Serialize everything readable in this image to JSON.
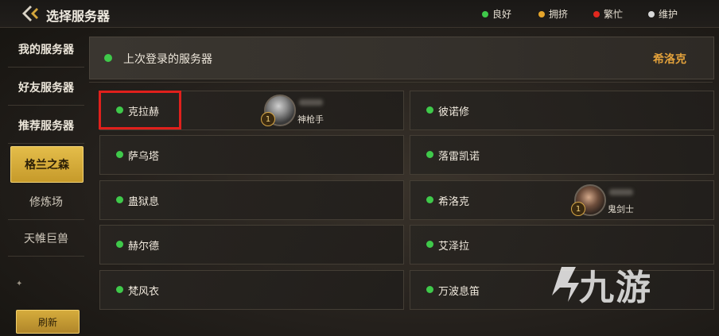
{
  "header": {
    "title": "选择服务器",
    "legend": [
      {
        "label": "良好",
        "color": "#3fc94a"
      },
      {
        "label": "拥挤",
        "color": "#e5a52b"
      },
      {
        "label": "繁忙",
        "color": "#e0281e"
      },
      {
        "label": "维护",
        "color": "#d8d8d8"
      }
    ]
  },
  "sidebar": {
    "items": [
      {
        "label": "我的服务器"
      },
      {
        "label": "好友服务器"
      },
      {
        "label": "推荐服务器"
      },
      {
        "label": "格兰之森",
        "active": true
      },
      {
        "label": "修炼场"
      },
      {
        "label": "天帷巨兽"
      }
    ],
    "refresh_label": "刷新"
  },
  "last_login": {
    "label": "上次登录的服务器",
    "server": "希洛克"
  },
  "servers": [
    {
      "name": "克拉赫",
      "status": "良好",
      "character": {
        "level": "1",
        "class": "神枪手"
      }
    },
    {
      "name": "彼诺修",
      "status": "良好"
    },
    {
      "name": "萨乌塔",
      "status": "良好"
    },
    {
      "name": "落雷凯诺",
      "status": "良好"
    },
    {
      "name": "蛊狱息",
      "status": "良好"
    },
    {
      "name": "希洛克",
      "status": "良好",
      "character": {
        "level": "1",
        "class": "鬼剑士"
      }
    },
    {
      "name": "赫尔德",
      "status": "良好"
    },
    {
      "name": "艾泽拉",
      "status": "良好"
    },
    {
      "name": "梵风衣",
      "status": "良好"
    },
    {
      "name": "万波息笛",
      "status": "良好"
    }
  ],
  "watermark": {
    "text": "九游"
  }
}
